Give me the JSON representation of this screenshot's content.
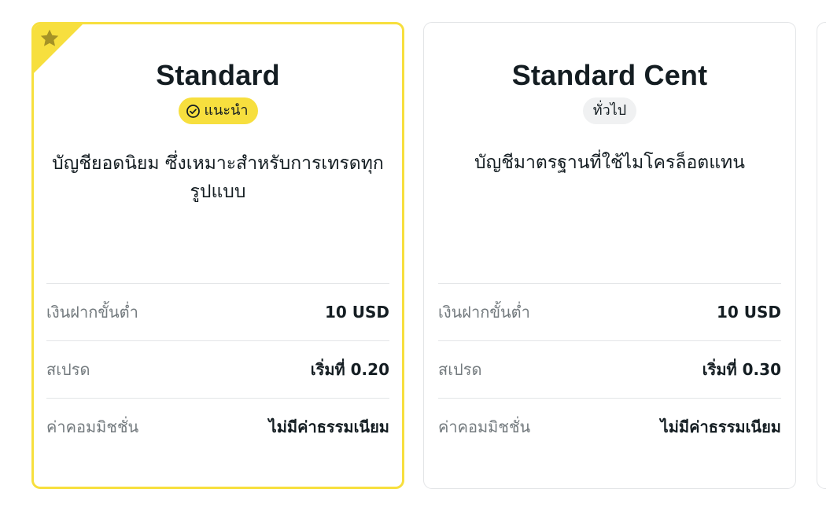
{
  "cards": [
    {
      "title": "Standard",
      "badge": "แนะนำ",
      "description": "บัญชียอดนิยม ซึ่งเหมาะสำหรับการเทรดทุกรูปแบบ",
      "rows": [
        {
          "label": "เงินฝากขั้นต่ำ",
          "value": "10 USD"
        },
        {
          "label": "สเปรด",
          "value": "เริ่มที่ 0.20"
        },
        {
          "label": "ค่าคอมมิชชั่น",
          "value": "ไม่มีค่าธรรมเนียม"
        }
      ]
    },
    {
      "title": "Standard Cent",
      "badge": "ทั่วไป",
      "description": "บัญชีมาตรฐานที่ใช้ไมโครล็อตแทน",
      "rows": [
        {
          "label": "เงินฝากขั้นต่ำ",
          "value": "10 USD"
        },
        {
          "label": "สเปรด",
          "value": "เริ่มที่ 0.30"
        },
        {
          "label": "ค่าคอมมิชชั่น",
          "value": "ไม่มีค่าธรรมเนียม"
        }
      ]
    }
  ],
  "icons": {
    "ribbon": "star-icon",
    "badge_recommended": "check-circle-icon"
  },
  "colors": {
    "accent_yellow": "#f7df3e",
    "star": "#a59226",
    "text": "#141d22",
    "muted_text": "#737a7e",
    "border": "#e3e5e7",
    "badge_grey": "#f0f1f2"
  }
}
